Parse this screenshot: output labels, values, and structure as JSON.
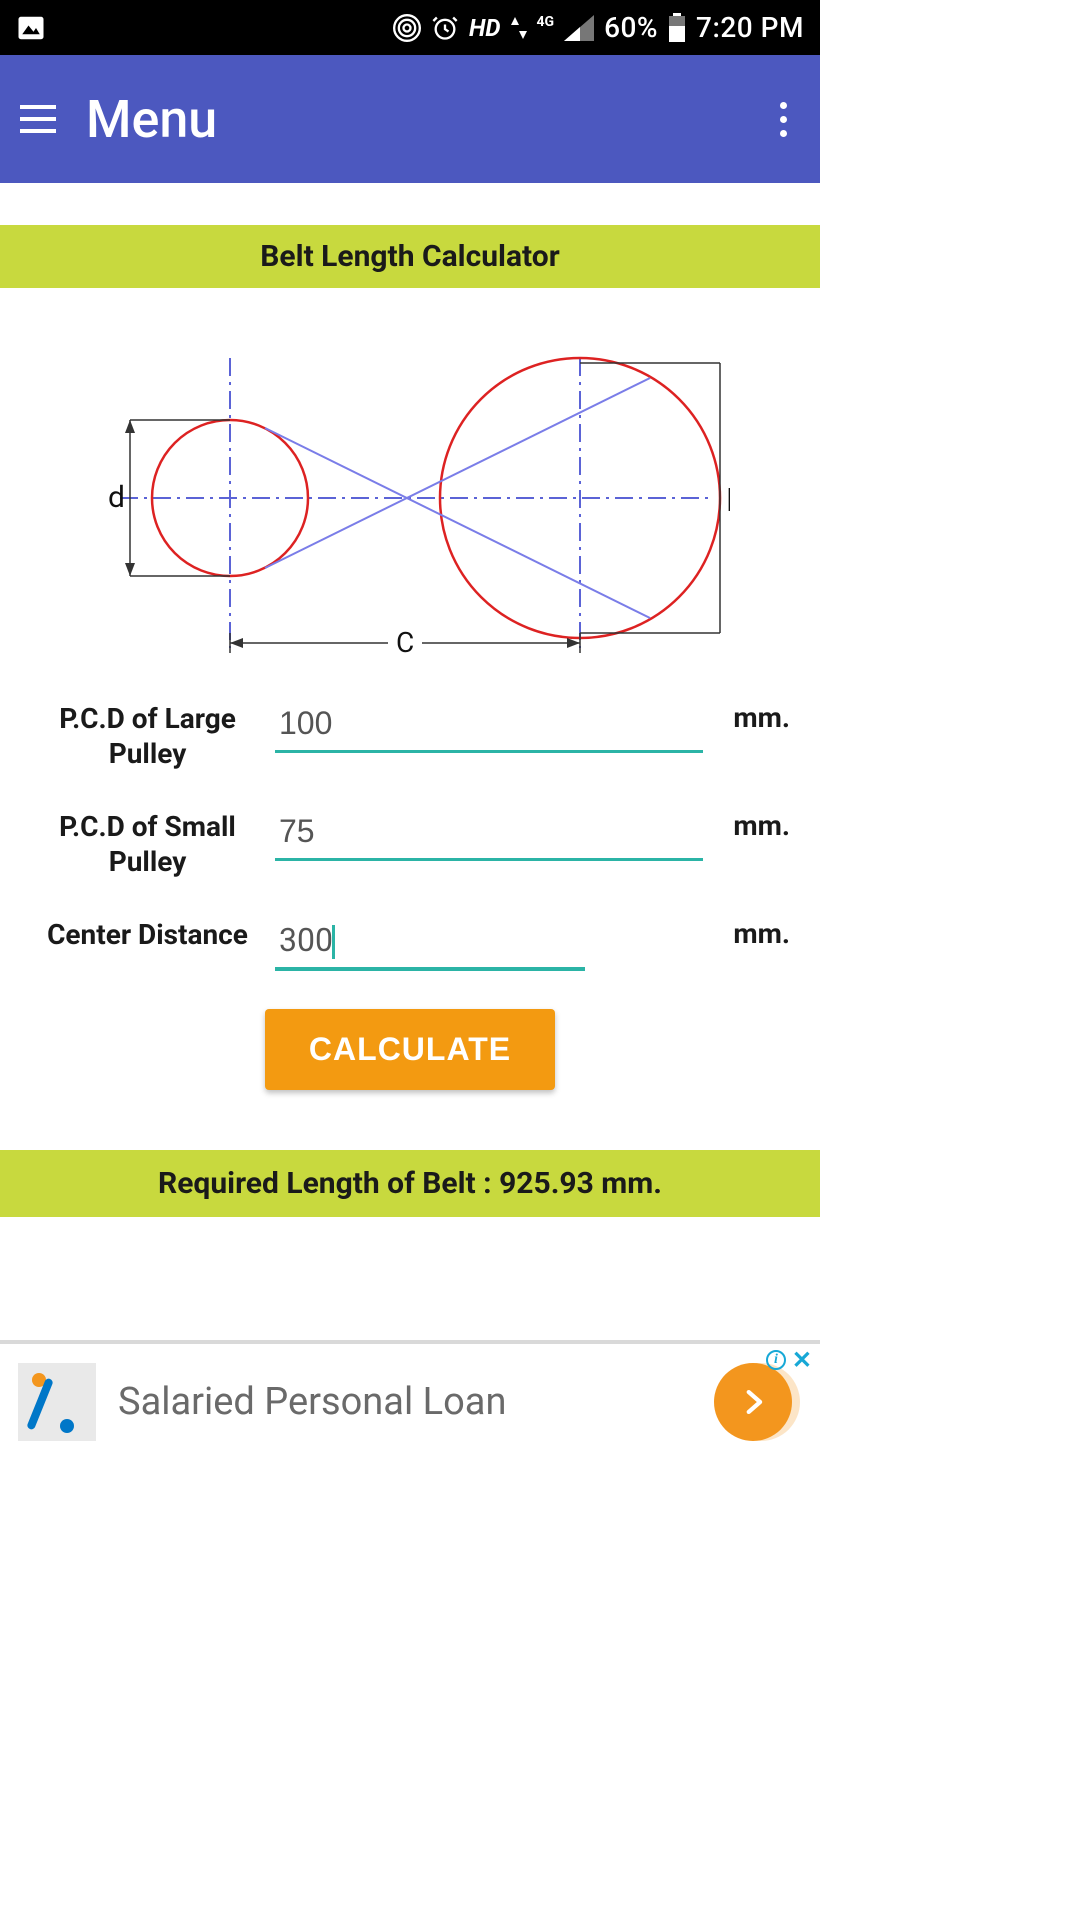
{
  "status_bar": {
    "hd_label": "HD",
    "network_label": "4G",
    "battery_percent": "60%",
    "time": "7:20 PM"
  },
  "app_bar": {
    "title": "Menu"
  },
  "section_title": "Belt Length Calculator",
  "diagram": {
    "label_small": "d",
    "label_large": "D",
    "label_center": "C"
  },
  "form": {
    "rows": [
      {
        "label": "P.C.D of Large Pulley",
        "value": "100",
        "unit": "mm."
      },
      {
        "label": "P.C.D of Small Pulley",
        "value": "75",
        "unit": "mm."
      },
      {
        "label": "Center Distance",
        "value": "300",
        "unit": "mm."
      }
    ],
    "calculate_label": "CALCULATE"
  },
  "result_text": "Required Length of Belt : 925.93 mm.",
  "ad": {
    "text": "Salaried Personal Loan",
    "info_label": "i",
    "close_label": "✕"
  }
}
